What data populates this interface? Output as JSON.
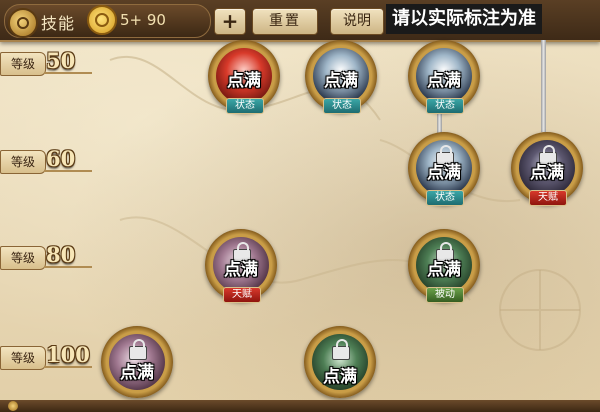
{
  "header": {
    "title": "技能",
    "points": "5+ 90",
    "plus_label": "+",
    "reset_label": "重置",
    "help_label": "说明",
    "note": "请以实际标注为准"
  },
  "levels": [
    {
      "tag": "等级",
      "num": "50"
    },
    {
      "tag": "等级",
      "num": "60"
    },
    {
      "tag": "等级",
      "num": "80"
    },
    {
      "tag": "等级",
      "num": "100"
    }
  ],
  "skills": [
    {
      "label": "点满",
      "type": "状态"
    },
    {
      "label": "点满",
      "type": "状态"
    },
    {
      "label": "点满",
      "type": "状态"
    },
    {
      "label": "点满",
      "type": "状态"
    },
    {
      "label": "点满",
      "type": "天赋"
    },
    {
      "label": "点满",
      "type": "天赋"
    },
    {
      "label": "点满",
      "type": "被动"
    },
    {
      "label": "点满",
      "type": ""
    },
    {
      "label": "点满",
      "type": ""
    }
  ]
}
